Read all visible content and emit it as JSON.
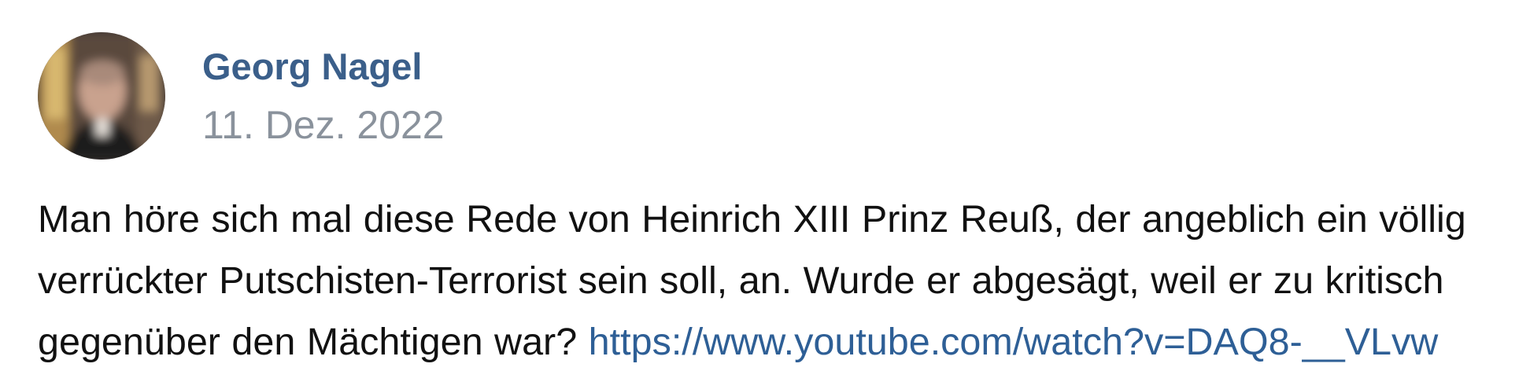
{
  "post": {
    "author": {
      "name": "Georg Nagel"
    },
    "date": "11. Dez. 2022",
    "text_line_1": "Man höre sich mal diese Rede von Heinrich XIII Prinz Reuß, der angeblich ein völlig",
    "text_line_2": "verrückter Putschisten-Terrorist sein soll, an. Wurde er abgesägt, weil er zu kritisch",
    "text_line_3": "gegenüber den Mächtigen war?",
    "link": "https://www.youtube.com/watch?v=DAQ8-__VLvw"
  },
  "colors": {
    "author_name": "#3b5f8a",
    "date": "#8a929c",
    "body_text": "#111111",
    "link": "#2e5f96"
  },
  "icons": {
    "avatar": "user-photo-avatar"
  }
}
